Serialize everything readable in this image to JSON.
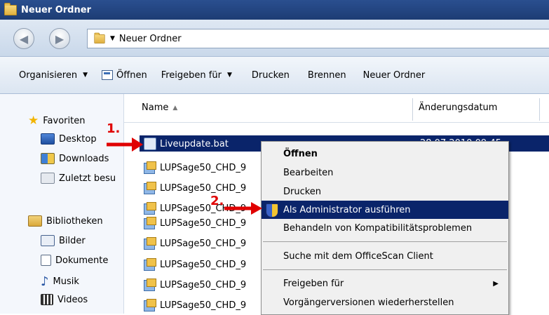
{
  "window": {
    "title": "Neuer Ordner"
  },
  "address": {
    "path": "Neuer Ordner"
  },
  "toolbar": {
    "items": [
      {
        "label": "Organisieren",
        "dropdown": true
      },
      {
        "label": "Öffnen",
        "icon": "open-icon"
      },
      {
        "label": "Freigeben für",
        "dropdown": true
      },
      {
        "label": "Drucken"
      },
      {
        "label": "Brennen"
      },
      {
        "label": "Neuer Ordner"
      }
    ]
  },
  "nav": {
    "favorites": "Favoriten",
    "desktop": "Desktop",
    "downloads": "Downloads",
    "recent": "Zuletzt besu",
    "libraries": "Bibliotheken",
    "pictures": "Bilder",
    "documents": "Dokumente",
    "music": "Musik",
    "videos": "Videos"
  },
  "columns": {
    "name": "Name",
    "date": "Änderungsdatum"
  },
  "files": {
    "selected": {
      "name": "Liveupdate.bat",
      "date": "28.07.2010 09:45"
    },
    "others": [
      "LUPSage50_CHD_9",
      "LUPSage50_CHD_9",
      "LUPSage50_CHD_9",
      "LUPSage50_CHD_9",
      "LUPSage50_CHD_9",
      "LUPSage50_CHD_9",
      "LUPSage50_CHD_9",
      "LUPSage50_CHD_9",
      "LUPSage50_CHD_9"
    ]
  },
  "context_menu": {
    "items": [
      "Öffnen",
      "Bearbeiten",
      "Drucken",
      "Als Administrator ausführen",
      "Behandeln von Kompatibilitätsproblemen",
      "Suche mit dem OfficeScan Client",
      "Freigeben für",
      "Vorgängerversionen wiederherstellen"
    ]
  },
  "annotations": {
    "step1": "1.",
    "step2": "2."
  },
  "colors": {
    "highlight": "#0a246a",
    "annotation": "#e00000"
  }
}
